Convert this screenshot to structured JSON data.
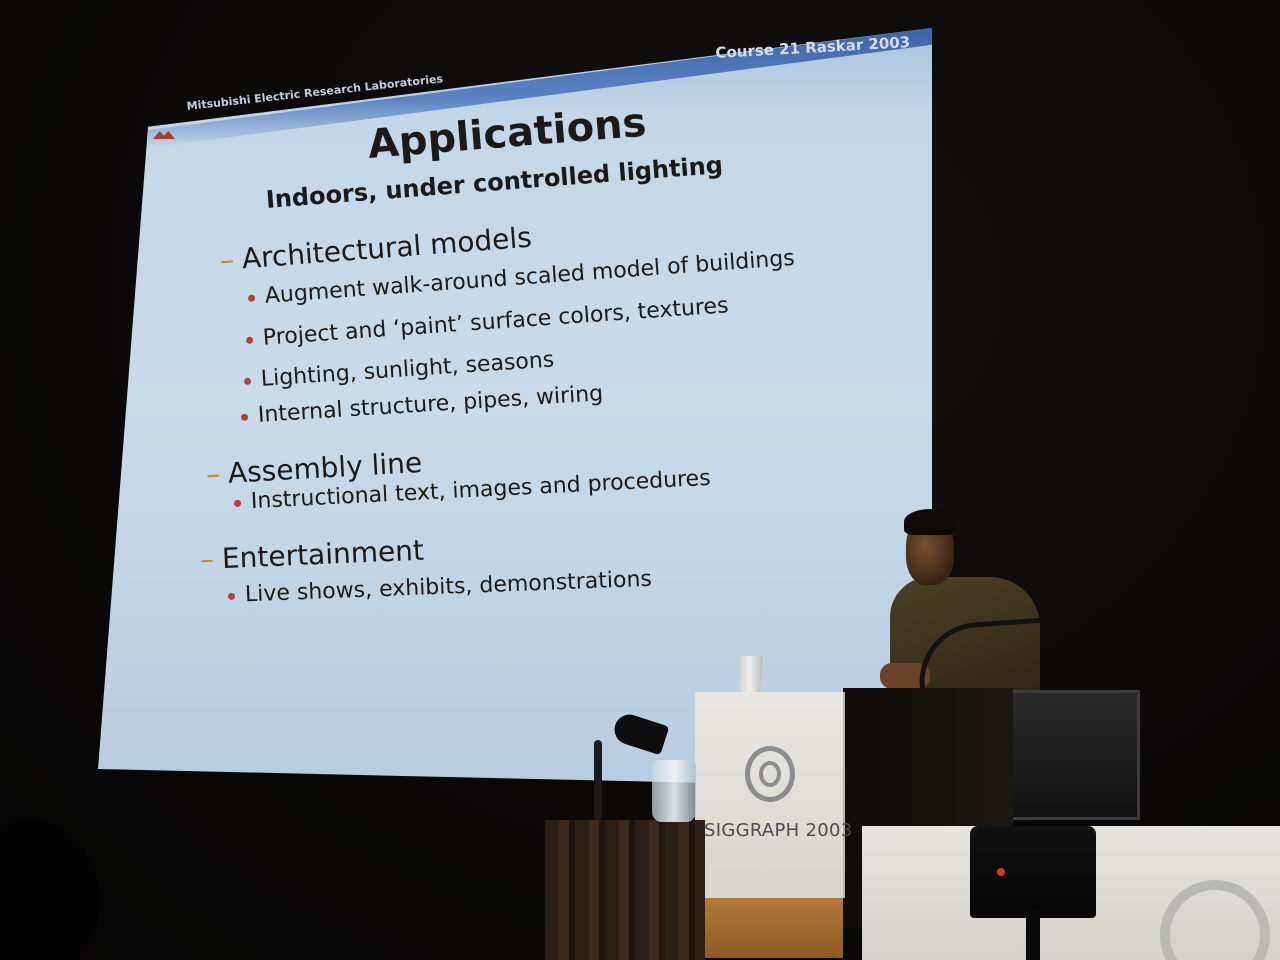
{
  "slide": {
    "header_left": "Mitsubishi Electric Research Laboratories",
    "header_right": "Course 21  Raskar 2003",
    "title": "Applications",
    "subtitle": "Indoors, under controlled lighting",
    "sections": [
      {
        "heading": "Architectural models",
        "items": [
          "Augment walk-around scaled model of buildings",
          "Project and ‘paint’ surface colors, textures",
          "Lighting, sunlight, seasons",
          "Internal structure, pipes, wiring"
        ]
      },
      {
        "heading": "Assembly line",
        "items": [
          "Instructional text, images and procedures"
        ]
      },
      {
        "heading": "Entertainment",
        "items": [
          "Live shows, exhibits, demonstrations"
        ]
      }
    ]
  },
  "podium": {
    "label": "SIGGRAPH 2003"
  },
  "colors": {
    "slide_background": "#c6d9e8",
    "slide_header_bar": "#4a70b4",
    "bullet_dash": "#c68b1c",
    "bullet_dot": "#b8402e",
    "room": "#080706"
  }
}
